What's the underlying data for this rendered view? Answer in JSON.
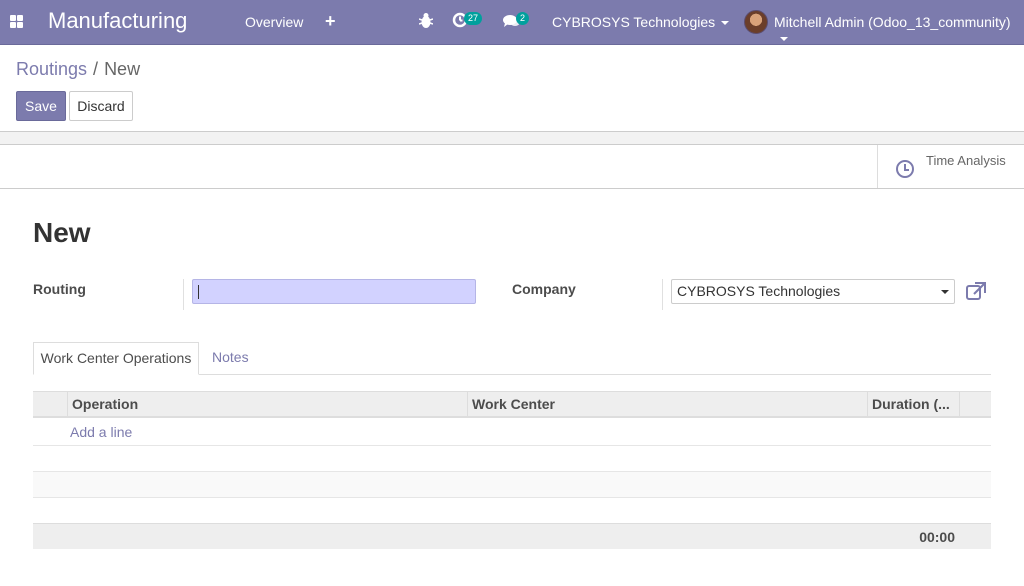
{
  "navbar": {
    "app_title": "Manufacturing",
    "menu_overview": "Overview",
    "menu_create": "+",
    "activity_count": "27",
    "message_count": "2",
    "company": "CYBROSYS Technologies",
    "user": "Mitchell Admin (Odoo_13_community)",
    "icons": [
      "apps-icon",
      "bug-icon",
      "activity-clock-icon",
      "chat-icon",
      "avatar"
    ]
  },
  "breadcrumb": {
    "parent": "Routings",
    "separator": "/",
    "current": "New"
  },
  "buttons": {
    "save": "Save",
    "discard": "Discard"
  },
  "smart_button": {
    "label": "Time Analysis",
    "icon": "clock-icon"
  },
  "form": {
    "title": "New",
    "routing_label": "Routing",
    "routing_value": "",
    "company_label": "Company",
    "company_value": "CYBROSYS Technologies"
  },
  "tabs": [
    {
      "label": "Work Center Operations",
      "active": true
    },
    {
      "label": "Notes",
      "active": false
    }
  ],
  "table": {
    "columns": [
      "Operation",
      "Work Center",
      "Duration (..."
    ],
    "add_line": "Add a line",
    "total_duration": "00:00"
  },
  "colors": {
    "primary": "#7c7bad",
    "badge": "#00a09d",
    "input_highlight": "#d2d2ff"
  }
}
